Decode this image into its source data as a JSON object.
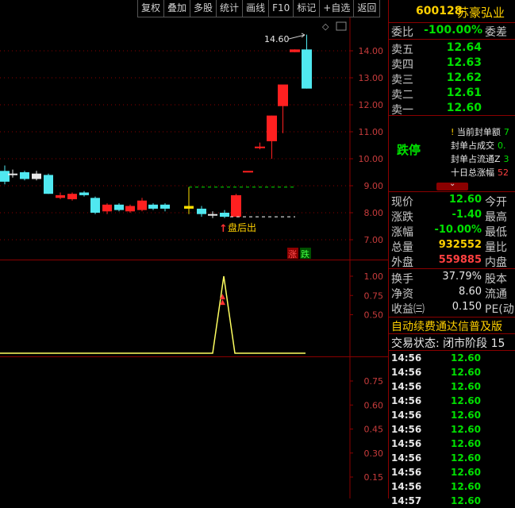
{
  "toolbar": {
    "buttons": [
      "复权",
      "叠加",
      "多股",
      "统计",
      "画线",
      "F10",
      "标记",
      "+自选",
      "返回"
    ]
  },
  "stock": {
    "code": "600128",
    "name": "苏豪弘业"
  },
  "main_chart": {
    "price_axis": [
      "14.00",
      "13.00",
      "12.00",
      "11.00",
      "10.00",
      "9.00",
      "8.00",
      "7.00"
    ],
    "max_label": "14.60",
    "after_hours_label": "盘后出",
    "legend_up": "涨",
    "legend_down": "跌",
    "candles": [
      {
        "o": 9.55,
        "h": 9.75,
        "l": 9.05,
        "c": 9.15,
        "color": "cyan"
      },
      {
        "o": 9.45,
        "h": 9.6,
        "l": 9.3,
        "c": 9.45,
        "color": "white"
      },
      {
        "o": 9.5,
        "h": 9.55,
        "l": 9.2,
        "c": 9.25,
        "color": "cyan"
      },
      {
        "o": 9.45,
        "h": 9.55,
        "l": 9.2,
        "c": 9.25,
        "color": "white"
      },
      {
        "o": 9.4,
        "h": 9.45,
        "l": 8.7,
        "c": 8.7,
        "color": "cyan"
      },
      {
        "o": 8.65,
        "h": 8.75,
        "l": 8.5,
        "c": 8.55,
        "color": "red"
      },
      {
        "o": 8.5,
        "h": 8.75,
        "l": 8.45,
        "c": 8.7,
        "color": "red"
      },
      {
        "o": 8.75,
        "h": 8.8,
        "l": 8.6,
        "c": 8.65,
        "color": "cyan"
      },
      {
        "o": 8.55,
        "h": 8.6,
        "l": 7.95,
        "c": 8.0,
        "color": "cyan"
      },
      {
        "o": 8.05,
        "h": 8.35,
        "l": 7.95,
        "c": 8.3,
        "color": "red"
      },
      {
        "o": 8.3,
        "h": 8.35,
        "l": 8.05,
        "c": 8.1,
        "color": "cyan"
      },
      {
        "o": 8.05,
        "h": 8.3,
        "l": 8.0,
        "c": 8.25,
        "color": "red"
      },
      {
        "o": 8.1,
        "h": 8.55,
        "l": 8.05,
        "c": 8.45,
        "color": "red"
      },
      {
        "o": 8.3,
        "h": 8.35,
        "l": 8.1,
        "c": 8.15,
        "color": "cyan"
      },
      {
        "o": 8.3,
        "h": 8.35,
        "l": 8.05,
        "c": 8.15,
        "color": "cyan"
      },
      {
        "o": 8.25,
        "h": 8.95,
        "l": 7.95,
        "c": 8.15,
        "color": "yellow"
      },
      {
        "o": 8.15,
        "h": 8.25,
        "l": 7.85,
        "c": 7.95,
        "color": "cyan"
      },
      {
        "o": 7.95,
        "h": 8.05,
        "l": 7.8,
        "c": 7.95,
        "color": "white"
      },
      {
        "o": 8.0,
        "h": 8.1,
        "l": 7.8,
        "c": 7.85,
        "color": "cyan"
      },
      {
        "o": 7.85,
        "h": 8.7,
        "l": 7.85,
        "c": 8.65,
        "color": "red"
      },
      {
        "o": 9.55,
        "h": 9.55,
        "l": 9.55,
        "c": 9.55,
        "color": "red"
      },
      {
        "o": 10.4,
        "h": 10.6,
        "l": 10.35,
        "c": 10.45,
        "color": "red"
      },
      {
        "o": 10.65,
        "h": 11.6,
        "l": 10.0,
        "c": 11.6,
        "color": "red"
      },
      {
        "o": 11.95,
        "h": 12.75,
        "l": 10.95,
        "c": 12.75,
        "color": "red"
      },
      {
        "o": 13.95,
        "h": 14.05,
        "l": 13.95,
        "c": 14.05,
        "color": "red"
      },
      {
        "o": 14.05,
        "h": 14.6,
        "l": 12.6,
        "c": 12.6,
        "color": "cyan"
      }
    ]
  },
  "indicator1": {
    "axis": [
      "1.00",
      "0.75",
      "0.50"
    ],
    "peak": 1.0
  },
  "indicator2": {
    "axis": [
      "0.75",
      "0.60",
      "0.45",
      "0.30",
      "0.15"
    ]
  },
  "order_book": {
    "webi_label": "委比",
    "webi_value": "-100.00%",
    "wecha_label": "委差",
    "asks": [
      {
        "label": "卖五",
        "price": "12.64"
      },
      {
        "label": "卖四",
        "price": "12.63"
      },
      {
        "label": "卖三",
        "price": "12.62"
      },
      {
        "label": "卖二",
        "price": "12.61"
      },
      {
        "label": "卖一",
        "price": "12.60"
      }
    ]
  },
  "limit_info": {
    "status": "跌停",
    "lines": [
      {
        "label": "当前封单额",
        "value": "7"
      },
      {
        "label": "封单占成交",
        "value": "0."
      },
      {
        "label": "封单占流通Z",
        "value": "3"
      },
      {
        "label": "十日总涨幅",
        "value": "52"
      }
    ]
  },
  "quote": {
    "rows": [
      {
        "l1": "现价",
        "v1": "12.60",
        "c1": "green",
        "l2": "今开"
      },
      {
        "l1": "涨跌",
        "v1": "-1.40",
        "c1": "green",
        "l2": "最高"
      },
      {
        "l1": "涨幅",
        "v1": "-10.00%",
        "c1": "green",
        "l2": "最低"
      },
      {
        "l1": "总量",
        "v1": "932552",
        "c1": "yellow",
        "l2": "量比"
      },
      {
        "l1": "外盘",
        "v1": "559885",
        "c1": "red",
        "l2": "内盘"
      }
    ],
    "rows2": [
      {
        "l1": "换手",
        "v1": "37.79%",
        "l2": "股本"
      },
      {
        "l1": "净资",
        "v1": "8.60",
        "l2": "流通"
      },
      {
        "l1": "收益㈢",
        "v1": "0.150",
        "l2": "PE(动"
      }
    ]
  },
  "marquee": "自动续费通达信普及版",
  "trade_status": "交易状态: 闭市阶段 15",
  "ticks": [
    {
      "time": "14:56",
      "price": "12.60"
    },
    {
      "time": "14:56",
      "price": "12.60"
    },
    {
      "time": "14:56",
      "price": "12.60"
    },
    {
      "time": "14:56",
      "price": "12.60"
    },
    {
      "time": "14:56",
      "price": "12.60"
    },
    {
      "time": "14:56",
      "price": "12.60"
    },
    {
      "time": "14:56",
      "price": "12.60"
    },
    {
      "time": "14:56",
      "price": "12.60"
    },
    {
      "time": "14:56",
      "price": "12.60"
    },
    {
      "time": "14:56",
      "price": "12.60"
    },
    {
      "time": "14:57",
      "price": "12.60"
    }
  ],
  "colors": {
    "up": "#ff2020",
    "down": "#50e8f0",
    "grid": "#8b0000",
    "axis_text": "#c83c3c"
  }
}
